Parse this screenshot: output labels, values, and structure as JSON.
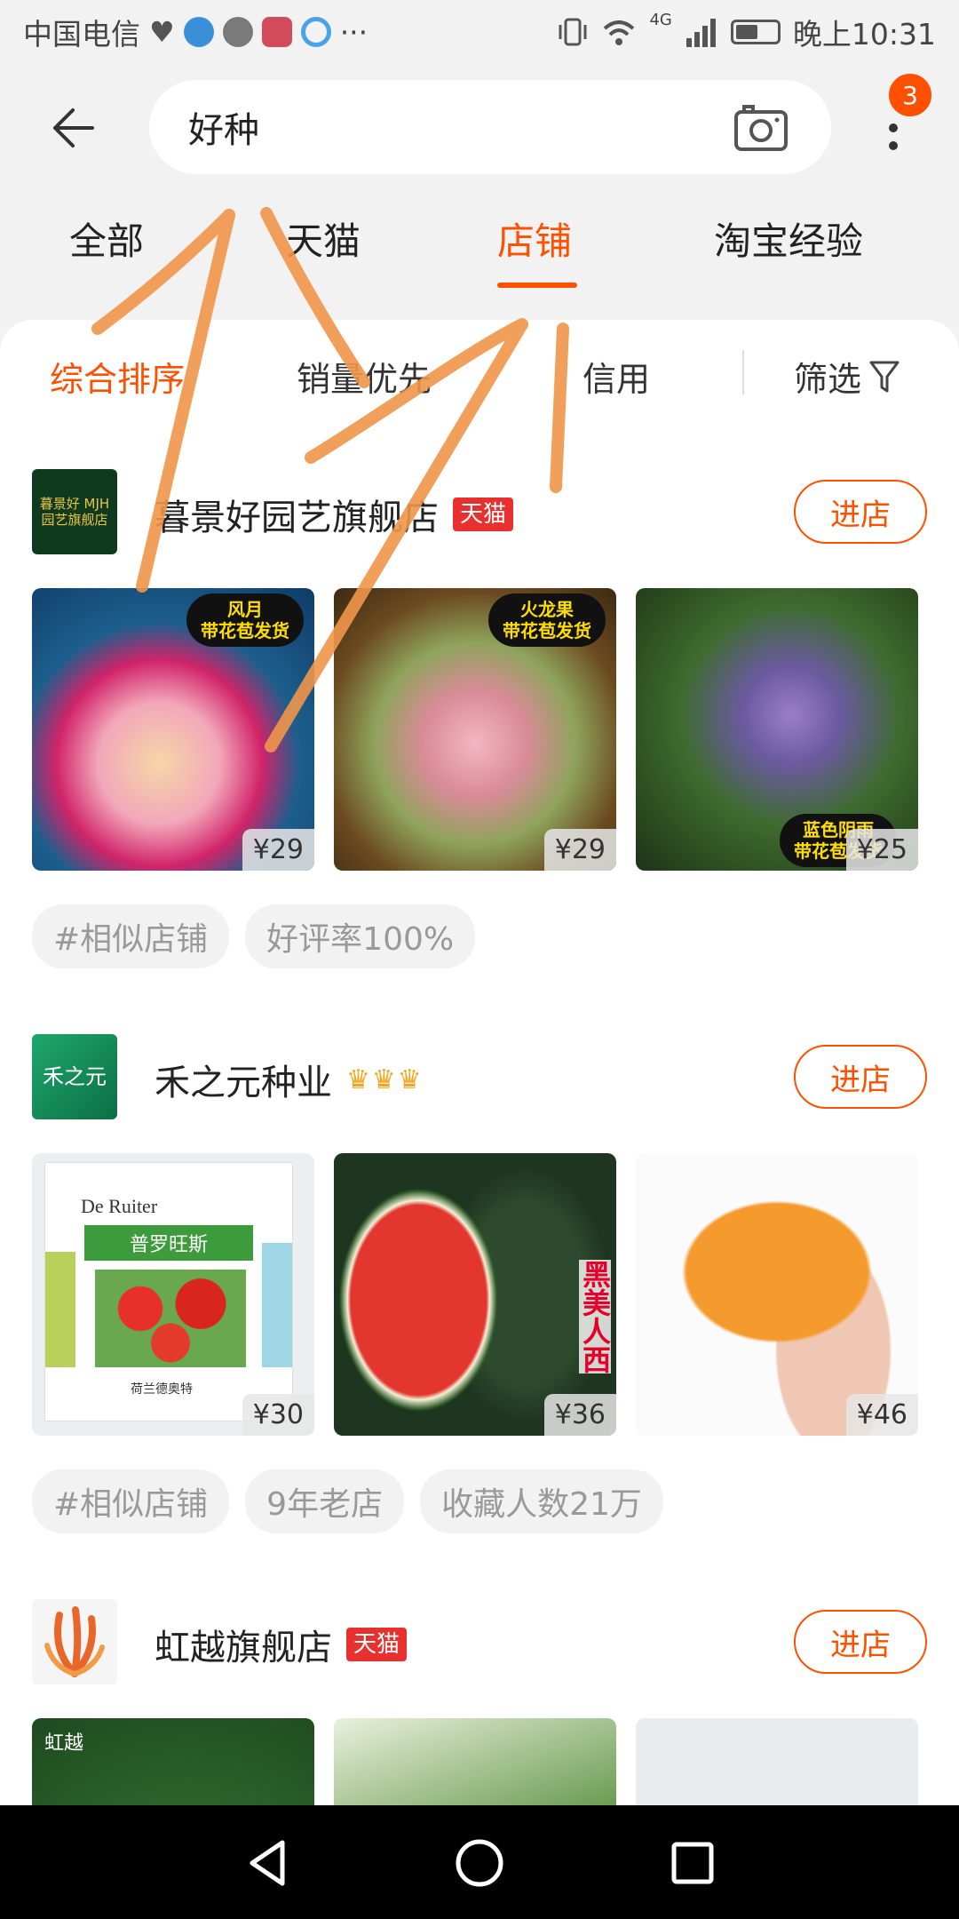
{
  "status_bar": {
    "carrier": "中国电信",
    "network": "4G",
    "time": "晚上10:31",
    "more": "···"
  },
  "search": {
    "query": "好种",
    "notification_count": "3"
  },
  "tabs": [
    {
      "label": "全部"
    },
    {
      "label": "天猫"
    },
    {
      "label": "店铺"
    },
    {
      "label": "淘宝经验"
    }
  ],
  "sort_bar": {
    "items": [
      {
        "label": "综合排序"
      },
      {
        "label": "销量优先"
      },
      {
        "label": "信用"
      }
    ],
    "filter_label": "筛选"
  },
  "shops": [
    {
      "name": "暮景好园艺旗舰店",
      "logo_text": "暮景好 MJH 园艺旗舰店",
      "badge": "天猫",
      "enter_label": "进店",
      "products": [
        {
          "price": "¥29",
          "sticker": "风月\n带花苞发货"
        },
        {
          "price": "¥29",
          "sticker": "火龙果\n带花苞发货"
        },
        {
          "price": "¥25",
          "sticker": "蓝色阴雨\n带花苞发货"
        }
      ],
      "tags": [
        "#相似店铺",
        "好评率100%"
      ]
    },
    {
      "name": "禾之元种业",
      "logo_text": "禾之元",
      "crowns": "♛♛♛",
      "enter_label": "进店",
      "products": [
        {
          "price": "¥30",
          "brand": "De Ruiter",
          "product_name": "普罗旺斯",
          "product_sub": "荷兰德奥特"
        },
        {
          "price": "¥36",
          "vertical_text": "黑美人西"
        },
        {
          "price": "¥46"
        }
      ],
      "tags": [
        "#相似店铺",
        "9年老店",
        "收藏人数21万"
      ]
    },
    {
      "name": "虹越旗舰店",
      "logo_text": "虹越",
      "badge": "天猫",
      "enter_label": "进店",
      "products": [
        {
          "price": "",
          "watermark": "虹越"
        },
        {
          "price": ""
        },
        {
          "price": ""
        }
      ]
    }
  ],
  "colors": {
    "accent": "#ff5000",
    "tmall_red": "#e8312f",
    "crown": "#f3a51f",
    "annotation": "#f0964a"
  }
}
